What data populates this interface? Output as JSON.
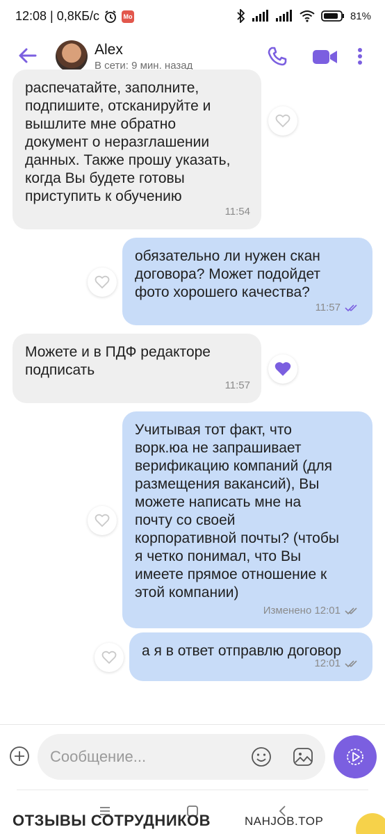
{
  "status_bar": {
    "time_speed": "12:08 | 0,8КБ/с",
    "app_badge": "Mo",
    "battery": "81"
  },
  "header": {
    "contact_name": "Alex",
    "contact_status": "В сети: 9 мин. назад"
  },
  "messages": [
    {
      "direction": "incoming",
      "text": "распечатайте, заполните,\nподпишите, отсканируйте и\nвышлите мне обратно\nдокумент о неразглашении\nданных. Также прошу указать,\nкогда Вы будете готовы\nприступить к обучению",
      "time": "11:54",
      "liked": false
    },
    {
      "direction": "outgoing",
      "text": "обязательно ли нужен скан\nдоговора? Может подойдет\nфото хорошего качества?",
      "time": "11:57",
      "liked": false
    },
    {
      "direction": "incoming",
      "text": "Можете и в ПДФ редакторе\nподписать",
      "time": "11:57",
      "liked": true
    },
    {
      "direction": "outgoing",
      "text": "Учитывая тот факт, что\nворк.юа не запрашивает\nверификацию компаний (для\nразмещения вакансий), Вы\nможете написать мне на\nпочту со своей\nкорпоративной почты? (чтобы\nя четко понимал, что Вы\nимеете прямое отношение к\nэтой компании)",
      "time": "Изменено 12:01",
      "liked": false
    },
    {
      "direction": "outgoing",
      "text": "а я в ответ отправлю договор",
      "time": "12:01",
      "liked": false
    }
  ],
  "composer": {
    "placeholder": "Сообщение..."
  },
  "watermark": {
    "left": "ОТЗЫВЫ СОТРУДНИКОВ",
    "right": "NAHJOB.TOP"
  },
  "colors": {
    "accent": "#7b5fe0",
    "incoming_bubble": "#efefef",
    "outgoing_bubble": "#c8dcf8"
  },
  "icons": {
    "back": "arrow-left-icon",
    "call": "phone-icon",
    "video": "video-camera-icon",
    "menu": "more-vertical-icon",
    "like": "heart-icon",
    "add": "plus-circle-icon",
    "emoji": "smiley-icon",
    "sticker": "sticker-icon",
    "send": "send-icon"
  }
}
